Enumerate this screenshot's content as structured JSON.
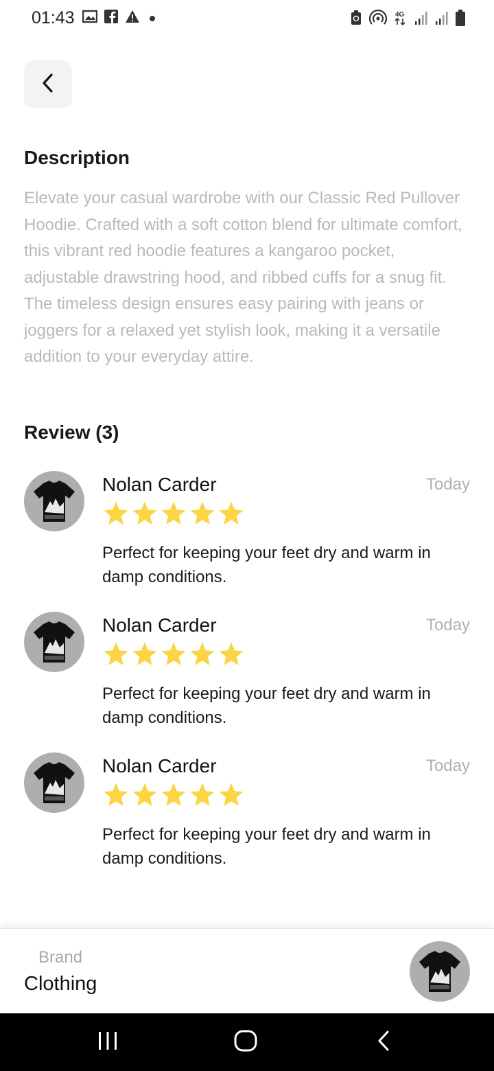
{
  "status_bar": {
    "time": "01:43",
    "left_icons": [
      "gallery-icon",
      "facebook-icon",
      "warning-icon",
      "dot-icon"
    ],
    "right_icons": [
      "battery-saver-icon",
      "hotspot-icon",
      "4g-icon",
      "signal-icon",
      "signal-icon",
      "battery-icon"
    ],
    "network_label": "4G"
  },
  "header": {
    "back_icon": "chevron-left-icon"
  },
  "description": {
    "title": "Description",
    "text": "Elevate your casual wardrobe with our Classic Red Pullover Hoodie. Crafted with a soft cotton blend for ultimate comfort, this vibrant red hoodie features a kangaroo pocket, adjustable drawstring hood, and ribbed cuffs for a snug fit. The timeless design ensures easy pairing with jeans or joggers for a relaxed yet stylish look, making it a versatile addition to your everyday attire."
  },
  "reviews": {
    "title": "Review (3)",
    "star_color": "#FDD443",
    "items": [
      {
        "name": "Nolan Carder",
        "date": "Today",
        "rating": 5,
        "text": "Perfect for keeping your feet dry and warm in damp conditions."
      },
      {
        "name": "Nolan Carder",
        "date": "Today",
        "rating": 5,
        "text": "Perfect for keeping your feet dry and warm in damp conditions."
      },
      {
        "name": "Nolan Carder",
        "date": "Today",
        "rating": 5,
        "text": "Perfect for keeping your feet dry and warm in damp conditions."
      }
    ]
  },
  "bottom_bar": {
    "brand_label": "Brand",
    "brand_value": "Clothing"
  },
  "nav_bar": {
    "icons": [
      "recent-apps-icon",
      "home-icon",
      "back-icon"
    ]
  }
}
